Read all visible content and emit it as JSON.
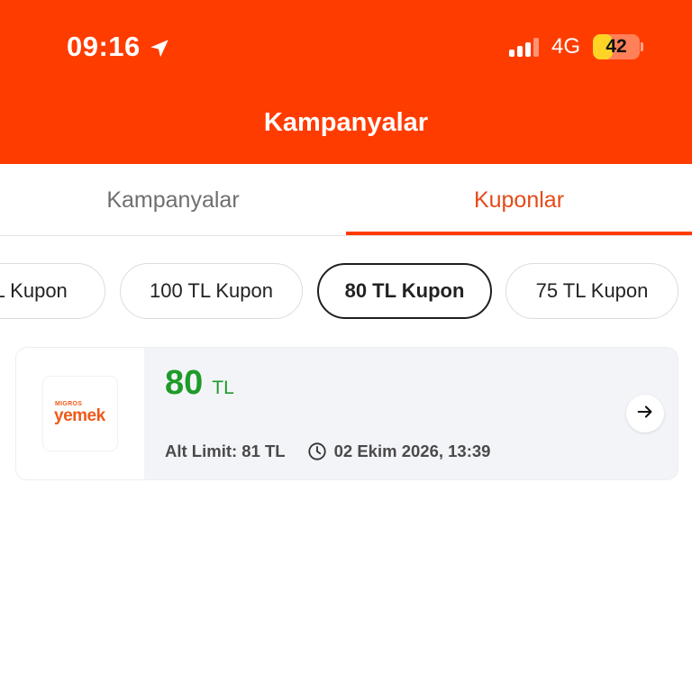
{
  "status_bar": {
    "time": "09:16",
    "network": "4G",
    "battery": "42",
    "battery_level": 0.42,
    "location_icon": "location-arrow-icon",
    "signal_icon": "cellular-signal-icon"
  },
  "nav": {
    "title": "Kampanyalar"
  },
  "tabs": [
    {
      "label": "Kampanyalar",
      "active": false
    },
    {
      "label": "Kuponlar",
      "active": true
    }
  ],
  "chips": [
    {
      "label": "TL Kupon",
      "active": false
    },
    {
      "label": "100 TL Kupon",
      "active": false
    },
    {
      "label": "80 TL Kupon",
      "active": true
    },
    {
      "label": "75 TL Kupon",
      "active": false
    }
  ],
  "coupon": {
    "logo_small": "MIGROS",
    "logo_main": "yemek",
    "amount": "80",
    "currency": "TL",
    "limit": "Alt Limit: 81 TL",
    "expiry": "02 Ekim 2026, 13:39",
    "clock_icon": "clock-icon",
    "arrow_icon": "arrow-right-icon"
  },
  "colors": {
    "brand": "#ff3c00",
    "active_tab": "#e64a19",
    "amount": "#1e9b2a",
    "battery_fill": "#ffd426"
  }
}
